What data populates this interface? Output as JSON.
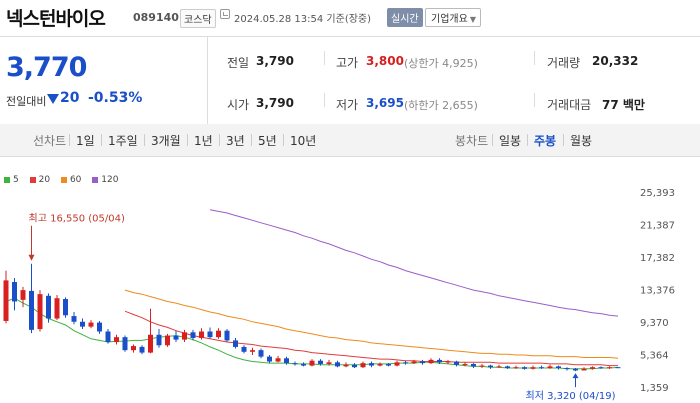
{
  "header": {
    "company": "넥스턴바이오",
    "code": "089140",
    "market": "코스닥",
    "datetime": "2024.05.28 13:54  기준(장중)",
    "realtime_label": "실시간",
    "company_info_label": "기업개요"
  },
  "quote": {
    "price": "3,770",
    "change_label": "전일대비",
    "change_value": "20",
    "change_pct": "-0.53%",
    "prev_close_label": "전일",
    "prev_close": "3,790",
    "high_label": "고가",
    "high": "3,800",
    "upper_limit": "(상한가 4,925)",
    "volume_label": "거래량",
    "volume": "20,332",
    "open_label": "시가",
    "open": "3,790",
    "low_label": "저가",
    "low": "3,695",
    "lower_limit": "(하한가 2,655)",
    "amount_label": "거래대금",
    "amount": "77 백만"
  },
  "tabs": {
    "line_chart_label": "선차트",
    "line_periods": [
      "1일",
      "1주일",
      "3개월",
      "1년",
      "3년",
      "5년",
      "10년"
    ],
    "candle_chart_label": "봉차트",
    "candle_periods": [
      "일봉",
      "주봉",
      "월봉"
    ],
    "active_candle": "주봉"
  },
  "colors": {
    "up": "#d91f1f",
    "down": "#1a4fc9",
    "ma5": "#3fb33f",
    "ma20": "#e23b3b",
    "ma60": "#f08a1c",
    "ma120": "#9a5ec8"
  },
  "chart_data": {
    "type": "candlestick",
    "legend": [
      "5",
      "20",
      "60",
      "120"
    ],
    "y_ticks": [
      "25,393",
      "21,387",
      "17,382",
      "13,376",
      "9,370",
      "5,364",
      "1,359"
    ],
    "ylim": [
      1359,
      25393
    ],
    "annotations": {
      "high": {
        "text": "최고 16,550 (05/04)",
        "value": 16550
      },
      "low": {
        "text": "최저 3,320 (04/19)",
        "value": 3320
      }
    },
    "candles": [
      [
        9500,
        14500,
        9200,
        15700
      ],
      [
        14300,
        11900,
        10800,
        14800
      ],
      [
        12100,
        13300,
        11200,
        13700
      ],
      [
        13200,
        8400,
        8000,
        16550
      ],
      [
        8500,
        12800,
        8200,
        13300
      ],
      [
        12600,
        9800,
        9300,
        12900
      ],
      [
        9800,
        12300,
        9600,
        12700
      ],
      [
        12200,
        10200,
        9900,
        12400
      ],
      [
        10100,
        9400,
        9100,
        10600
      ],
      [
        9400,
        8800,
        8500,
        9800
      ],
      [
        8800,
        9300,
        8600,
        9600
      ],
      [
        9300,
        8200,
        7900,
        9500
      ],
      [
        8200,
        6900,
        6700,
        8500
      ],
      [
        6900,
        7500,
        6600,
        7800
      ],
      [
        7500,
        5900,
        5700,
        7700
      ],
      [
        5900,
        6400,
        5600,
        6600
      ],
      [
        6300,
        5600,
        5400,
        6500
      ],
      [
        5600,
        7800,
        5500,
        11000
      ],
      [
        7800,
        6500,
        6200,
        8500
      ],
      [
        6500,
        7700,
        6300,
        7900
      ],
      [
        7700,
        7200,
        6900,
        8300
      ],
      [
        7200,
        8100,
        6900,
        8400
      ],
      [
        8100,
        7400,
        7100,
        8400
      ],
      [
        7400,
        8200,
        7200,
        8600
      ],
      [
        8200,
        7500,
        7300,
        8700
      ],
      [
        7500,
        8300,
        7300,
        8600
      ],
      [
        8300,
        7100,
        6900,
        8500
      ],
      [
        7100,
        6300,
        6100,
        7400
      ],
      [
        6300,
        5700,
        5500,
        6500
      ],
      [
        5700,
        5900,
        5300,
        6200
      ],
      [
        5900,
        5100,
        4900,
        6100
      ],
      [
        5100,
        4500,
        4300,
        5300
      ],
      [
        4500,
        4900,
        4400,
        5200
      ],
      [
        4900,
        4300,
        4100,
        5100
      ],
      [
        4300,
        4200,
        4000,
        4500
      ],
      [
        4200,
        4000,
        3900,
        4400
      ],
      [
        4000,
        4600,
        3900,
        4800
      ],
      [
        4600,
        4200,
        4000,
        4800
      ],
      [
        4200,
        4400,
        4000,
        4700
      ],
      [
        4400,
        3900,
        3800,
        4600
      ],
      [
        3900,
        4100,
        3800,
        4400
      ],
      [
        4100,
        3800,
        3700,
        4300
      ],
      [
        3800,
        4300,
        3700,
        4500
      ],
      [
        4300,
        4000,
        3800,
        4500
      ],
      [
        4000,
        4200,
        3900,
        4400
      ],
      [
        4200,
        4000,
        3900,
        4300
      ],
      [
        4000,
        4400,
        3900,
        4600
      ],
      [
        4400,
        4300,
        4100,
        4600
      ],
      [
        4300,
        4500,
        4200,
        4700
      ],
      [
        4500,
        4300,
        4100,
        4700
      ],
      [
        4300,
        4700,
        4200,
        4900
      ],
      [
        4700,
        4400,
        4200,
        4900
      ],
      [
        4400,
        4500,
        4200,
        4700
      ],
      [
        4500,
        4100,
        3900,
        4600
      ],
      [
        4100,
        4200,
        3900,
        4400
      ],
      [
        4200,
        3900,
        3700,
        4300
      ],
      [
        3900,
        4000,
        3700,
        4200
      ],
      [
        4000,
        3800,
        3600,
        4100
      ],
      [
        3800,
        3900,
        3700,
        4100
      ],
      [
        3900,
        3700,
        3600,
        4000
      ],
      [
        3700,
        3800,
        3600,
        4000
      ],
      [
        3800,
        3600,
        3500,
        3900
      ],
      [
        3600,
        3800,
        3500,
        4000
      ],
      [
        3800,
        3700,
        3600,
        4000
      ],
      [
        3700,
        3900,
        3600,
        4100
      ],
      [
        3900,
        3700,
        3500,
        4000
      ],
      [
        3700,
        3600,
        3400,
        3800
      ],
      [
        3600,
        3400,
        3320,
        3700
      ],
      [
        3400,
        3600,
        3400,
        3800
      ],
      [
        3600,
        3800,
        3500,
        3900
      ],
      [
        3800,
        3700,
        3600,
        3900
      ],
      [
        3700,
        3800,
        3600,
        3900
      ],
      [
        3800,
        3770,
        3695,
        3800
      ]
    ],
    "ma5": [
      11900,
      12300,
      11700,
      11200,
      10400,
      9800,
      9400,
      9000,
      8300,
      7800,
      7300,
      7100,
      6900,
      7000,
      7000,
      7100,
      7100,
      7300,
      7500,
      7600,
      7700,
      7500,
      7200,
      6800,
      6300,
      5900,
      5400,
      5000,
      4700,
      4500,
      4400,
      4300,
      4300,
      4300,
      4200,
      4200,
      4200,
      4100,
      4100,
      4100,
      4100,
      4100,
      4100,
      4200,
      4200,
      4200,
      4300,
      4300,
      4300,
      4400,
      4400,
      4300,
      4200,
      4100,
      4000,
      3900,
      3900,
      3800,
      3800,
      3700,
      3700,
      3700,
      3700,
      3700,
      3700,
      3700,
      3600,
      3600,
      3600,
      3600,
      3700,
      3700,
      3770
    ],
    "ma20": [
      10700,
      10300,
      9900,
      9400,
      9000,
      8700,
      8300,
      8000,
      7700,
      7500,
      7300,
      7100,
      6900,
      6800,
      6700,
      6600,
      6400,
      6300,
      6200,
      6100,
      5900,
      5800,
      5600,
      5500,
      5400,
      5300,
      5200,
      5100,
      5000,
      4900,
      4800,
      4800,
      4700,
      4600,
      4600,
      4500,
      4500,
      4500,
      4500,
      4400,
      4400,
      4400,
      4400,
      4400,
      4300,
      4300,
      4300,
      4300,
      4300,
      4300,
      4200,
      4200,
      4200,
      4100,
      4100,
      4100,
      4100,
      4000,
      4000
    ],
    "ma60": [
      13300,
      13000,
      12800,
      12500,
      12200,
      11900,
      11700,
      11400,
      11200,
      10900,
      10600,
      10400,
      10100,
      9900,
      9700,
      9400,
      9200,
      9000,
      8800,
      8500,
      8300,
      8100,
      7900,
      7700,
      7500,
      7400,
      7200,
      7100,
      7000,
      6800,
      6700,
      6600,
      6500,
      6400,
      6300,
      6200,
      6100,
      6000,
      5900,
      5800,
      5700,
      5600,
      5500,
      5500,
      5400,
      5400,
      5300,
      5300,
      5200,
      5200,
      5200,
      5100,
      5100,
      5100,
      5000,
      5000,
      5000,
      5000,
      4900
    ],
    "ma120": [
      23200,
      23000,
      22800,
      22500,
      22200,
      21900,
      21600,
      21300,
      21000,
      20700,
      20400,
      20000,
      19700,
      19300,
      19000,
      18600,
      18200,
      17900,
      17500,
      17100,
      16800,
      16400,
      16100,
      15700,
      15400,
      15100,
      14800,
      14500,
      14200,
      13900,
      13600,
      13300,
      13100,
      12900,
      12600,
      12400,
      12200,
      12000,
      11800,
      11600,
      11400,
      11200,
      11000,
      10900,
      10700,
      10500,
      10400,
      10200,
      10100
    ]
  }
}
